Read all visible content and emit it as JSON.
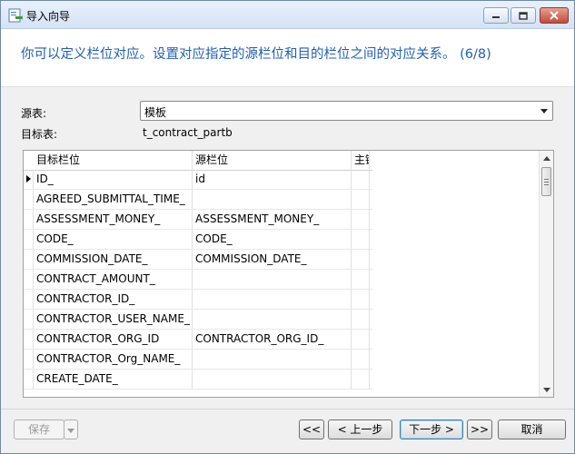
{
  "window": {
    "title": "导入向导",
    "icon": "import-wizard-icon"
  },
  "header": {
    "instruction": "你可以定义栏位对应。设置对应指定的源栏位和目的栏位之间的对应关系。 (6/8)"
  },
  "form": {
    "source_label": "源表:",
    "source_value": "模板",
    "target_label": "目标表:",
    "target_value": "t_contract_partb"
  },
  "grid": {
    "columns": [
      "目标栏位",
      "源栏位",
      "主键"
    ],
    "current_row": 0,
    "rows": [
      {
        "target": "ID_",
        "source": "id"
      },
      {
        "target": "AGREED_SUBMITTAL_TIME_",
        "source": ""
      },
      {
        "target": "ASSESSMENT_MONEY_",
        "source": "ASSESSMENT_MONEY_"
      },
      {
        "target": "CODE_",
        "source": "CODE_"
      },
      {
        "target": "COMMISSION_DATE_",
        "source": "COMMISSION_DATE_"
      },
      {
        "target": "CONTRACT_AMOUNT_",
        "source": ""
      },
      {
        "target": "CONTRACTOR_ID_",
        "source": ""
      },
      {
        "target": "CONTRACTOR_USER_NAME_",
        "source": ""
      },
      {
        "target": "CONTRACTOR_ORG_ID",
        "source": "CONTRACTOR_ORG_ID_"
      },
      {
        "target": "CONTRACTOR_Org_NAME_",
        "source": ""
      },
      {
        "target": "CREATE_DATE_",
        "source": ""
      }
    ]
  },
  "buttons": {
    "save": "保存",
    "first": "<<",
    "prev": "< 上一步",
    "next": "下一步 >",
    "last": ">>",
    "cancel": "取消"
  },
  "colors": {
    "header_text": "#1f5fb5",
    "close_button": "#c24a3b"
  }
}
